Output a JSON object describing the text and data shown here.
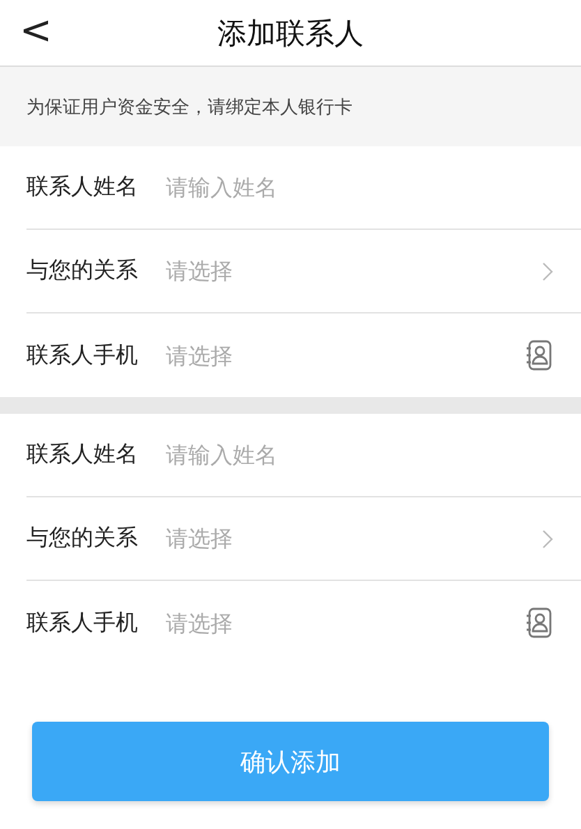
{
  "header": {
    "back_icon": "<",
    "title": "添加联系人"
  },
  "notice": "为保证用户资金安全，请绑定本人银行卡",
  "groups": [
    {
      "rows": [
        {
          "kind": "input",
          "label": "联系人姓名",
          "placeholder": "请输入姓名"
        },
        {
          "kind": "select",
          "label": "与您的关系",
          "placeholder": "请选择"
        },
        {
          "kind": "contact",
          "label": "联系人手机",
          "placeholder": "请选择"
        }
      ]
    },
    {
      "rows": [
        {
          "kind": "input",
          "label": "联系人姓名",
          "placeholder": "请输入姓名"
        },
        {
          "kind": "select",
          "label": "与您的关系",
          "placeholder": "请选择"
        },
        {
          "kind": "contact",
          "label": "联系人手机",
          "placeholder": "请选择"
        }
      ]
    }
  ],
  "submit_button": "确认添加"
}
